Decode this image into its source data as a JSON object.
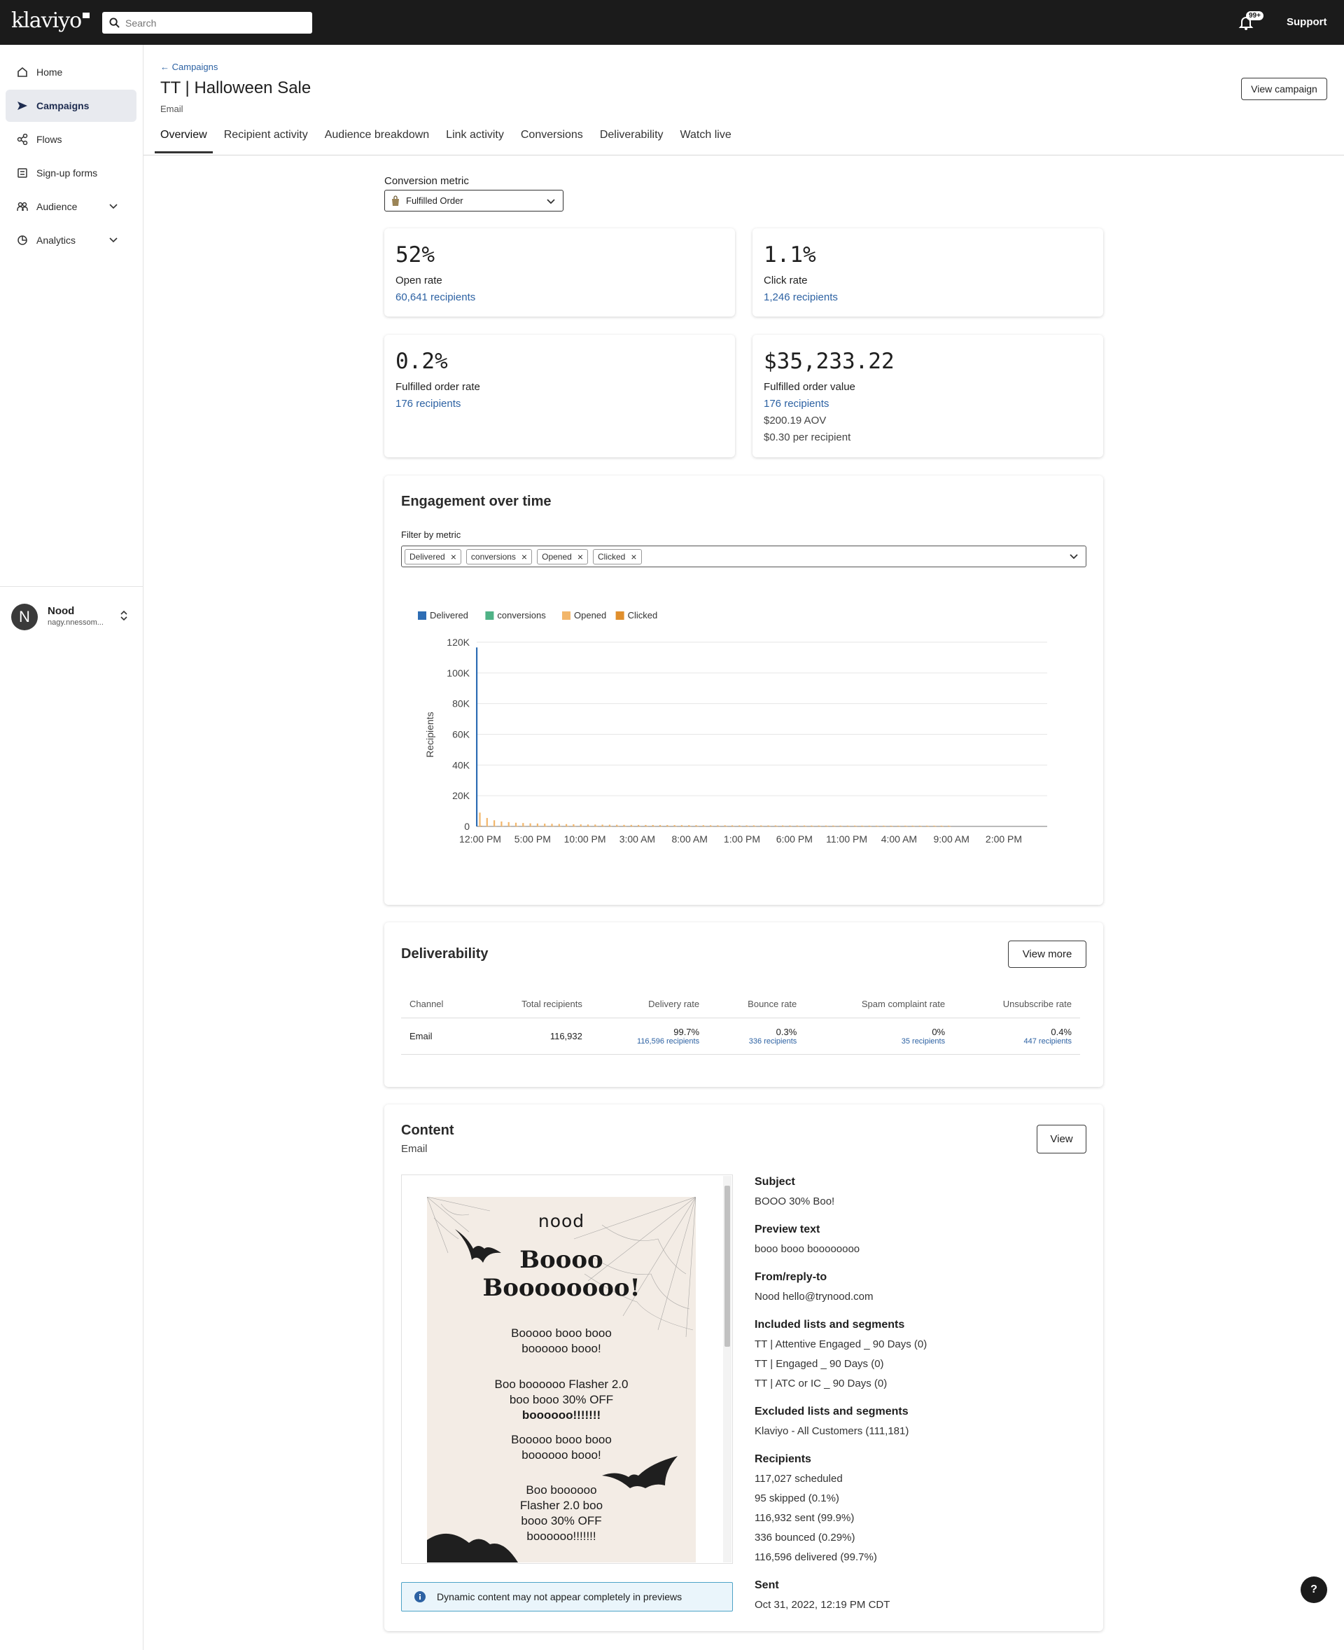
{
  "topbar": {
    "logo": "klaviyo",
    "search_placeholder": "Search",
    "notif_count": "99+",
    "support": "Support"
  },
  "sidebar": {
    "items": [
      {
        "label": "Home"
      },
      {
        "label": "Campaigns"
      },
      {
        "label": "Flows"
      },
      {
        "label": "Sign-up forms"
      },
      {
        "label": "Audience"
      },
      {
        "label": "Analytics"
      }
    ],
    "account": {
      "initial": "N",
      "name": "Nood",
      "email": "nagy.nnessom..."
    }
  },
  "header": {
    "back_link": "Campaigns",
    "title": "TT | Halloween Sale",
    "subtitle": "Email",
    "view_campaign": "View campaign"
  },
  "tabs": [
    "Overview",
    "Recipient activity",
    "Audience breakdown",
    "Link activity",
    "Conversions",
    "Deliverability",
    "Watch live"
  ],
  "conversion": {
    "label": "Conversion metric",
    "value": "Fulfilled Order"
  },
  "stats": {
    "open": {
      "value": "52%",
      "label": "Open rate",
      "link": "60,641 recipients"
    },
    "click": {
      "value": "1.1%",
      "label": "Click rate",
      "link": "1,246 recipients"
    },
    "order_rate": {
      "value": "0.2%",
      "label": "Fulfilled order rate",
      "link": "176 recipients"
    },
    "order_value": {
      "value": "$35,233.22",
      "label": "Fulfilled order value",
      "link": "176 recipients",
      "aov": "$200.19 AOV",
      "per_recipient": "$0.30 per recipient"
    }
  },
  "engagement": {
    "title": "Engagement over time",
    "filter_label": "Filter by metric",
    "chips": [
      "Delivered",
      "conversions",
      "Opened",
      "Clicked"
    ]
  },
  "chart_data": {
    "type": "bar",
    "ylabel": "Recipients",
    "ylim": [
      0,
      120000
    ],
    "yticks": [
      "0",
      "20K",
      "40K",
      "60K",
      "80K",
      "100K",
      "120K"
    ],
    "xticks": [
      "12:00 PM",
      "5:00 PM",
      "10:00 PM",
      "3:00 AM",
      "8:00 AM",
      "1:00 PM",
      "6:00 PM",
      "11:00 PM",
      "4:00 AM",
      "9:00 AM",
      "2:00 PM"
    ],
    "series": [
      {
        "name": "Delivered",
        "color": "#2e6db4",
        "values": [
          116596
        ]
      },
      {
        "name": "conversions",
        "color": "#4fb286",
        "values": [
          0
        ]
      },
      {
        "name": "Opened",
        "color": "#f2b66b",
        "values": [
          9000,
          5500,
          4000,
          3200,
          2800,
          2400,
          2200,
          2000,
          1900,
          1800,
          1700,
          1600,
          1500,
          1400,
          1300,
          1250,
          1200,
          1150,
          1100,
          1050,
          1000,
          980,
          960,
          940,
          920,
          900,
          880,
          860,
          840,
          820,
          800,
          780,
          760,
          740,
          720,
          700,
          690,
          680,
          670,
          660,
          650,
          640,
          630,
          620,
          610,
          600,
          590,
          580,
          570,
          560,
          550,
          540,
          530,
          520,
          510,
          500,
          500,
          500,
          500,
          500,
          500,
          500,
          500,
          500,
          500,
          500
        ]
      },
      {
        "name": "Clicked",
        "color": "#e08f2d",
        "values": [
          400,
          200,
          150,
          120,
          100,
          90,
          80,
          70,
          60,
          60,
          55,
          50,
          50,
          45,
          45,
          40,
          40,
          40,
          35,
          35,
          30,
          30,
          30,
          30,
          30,
          30,
          30,
          30,
          30,
          30,
          30,
          30,
          30,
          30,
          30,
          30,
          30,
          30,
          30,
          30,
          30,
          30,
          30,
          30,
          30,
          30,
          30,
          30,
          30,
          30,
          30,
          30,
          30,
          30,
          30,
          30,
          30,
          30,
          30,
          30,
          30,
          30,
          30,
          30,
          30,
          30
        ]
      }
    ]
  },
  "deliverability": {
    "title": "Deliverability",
    "view_more": "View more",
    "headers": [
      "Channel",
      "Total recipients",
      "Delivery rate",
      "Bounce rate",
      "Spam complaint rate",
      "Unsubscribe rate"
    ],
    "row": {
      "channel": "Email",
      "total": "116,932",
      "delivery": "99.7%",
      "delivery_sub": "116,596 recipients",
      "bounce": "0.3%",
      "bounce_sub": "336 recipients",
      "spam": "0%",
      "spam_sub": "35 recipients",
      "unsub": "0.4%",
      "unsub_sub": "447 recipients"
    }
  },
  "content": {
    "title": "Content",
    "subtitle": "Email",
    "view": "View",
    "notice": "Dynamic content may not appear completely in previews",
    "preview": {
      "brand": "nood",
      "headline1": "Boooo",
      "headline2": "Boooooooo!",
      "p1a": "Booooo booo booo",
      "p1b": "boooooo booo!",
      "p2a": "Boo boooooo Flasher 2.0",
      "p2b": "boo booo 30% OFF",
      "p2c": "boooooo!!!!!!!",
      "p3a": "Booooo booo booo",
      "p3b": "boooooo booo!",
      "p4a": "Boo boooooo",
      "p4b": "Flasher 2.0 boo",
      "p4c": "booo 30% OFF",
      "p4d": "boooooo!!!!!!!"
    },
    "meta": {
      "subject_h": "Subject",
      "subject": "BOOO 30% Boo!",
      "preview_h": "Preview text",
      "preview": "booo booo boooooooo",
      "from_h": "From/reply-to",
      "from": "Nood hello@trynood.com",
      "included_h": "Included lists and segments",
      "included": [
        "TT | Attentive Engaged _ 90 Days (0)",
        "TT | Engaged _ 90 Days (0)",
        "TT | ATC or IC _ 90 Days (0)"
      ],
      "excluded_h": "Excluded lists and segments",
      "excluded": "Klaviyo - All Customers (111,181)",
      "recipients_h": "Recipients",
      "recipients": [
        "117,027 scheduled",
        "95 skipped (0.1%)",
        "116,932 sent (99.9%)",
        "336 bounced (0.29%)",
        "116,596 delivered (99.7%)"
      ],
      "sent_h": "Sent",
      "sent": "Oct 31, 2022, 12:19 PM CDT"
    }
  },
  "help": "?"
}
